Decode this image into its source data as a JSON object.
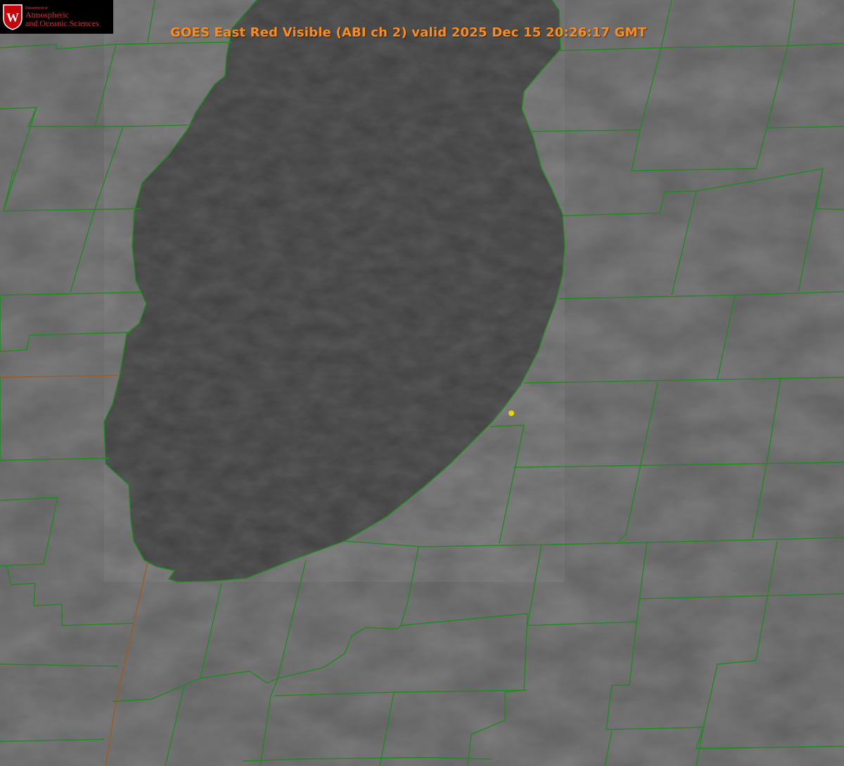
{
  "title": "GOES East Red Visible (ABI ch 2) valid 2025 Dec 15 20:26:17 GMT",
  "logo": {
    "crest_letter": "W",
    "dept": "Department of",
    "line1": "Atmospheric",
    "line2": "and Oceanic Sciences"
  },
  "colors": {
    "land": "#5e5e5e",
    "lake": "#3f3f3f",
    "county_lines": "#1f8a1f",
    "shoreline_dash": "#ff3b3b",
    "title": "#ff8c1a",
    "marker": "#e6d500"
  },
  "icons": {
    "logo": "uw-crest-icon",
    "marker": "location-dot-icon"
  }
}
